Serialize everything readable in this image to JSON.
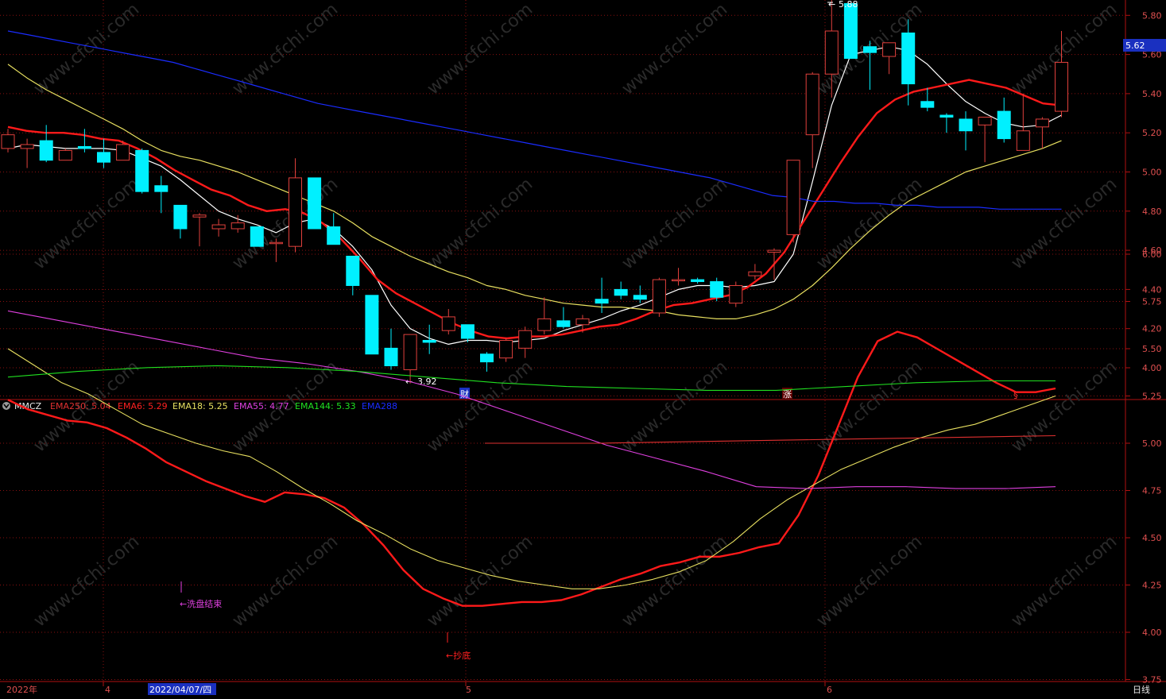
{
  "colors": {
    "bg": "#000000",
    "frame": "#b01010",
    "grid": "#8a1010",
    "up": "#e0403c",
    "down": "#00f0ff",
    "ema6": "#ff1a1a",
    "ema18": "#e8e060",
    "ema55": "#e040e0",
    "ema144": "#20e020",
    "ema250": "#e03030",
    "ema288": "#1a2cff",
    "ma_white": "#ffffff",
    "axis_text": "#e05050",
    "current_price_bg": "#1a30c0"
  },
  "main_panel": {
    "y_ticks": [
      "5.80",
      "5.60",
      "5.40",
      "5.20",
      "5.00",
      "4.80",
      "4.60",
      "4.40",
      "4.20",
      "4.00"
    ],
    "current_price": "5.62",
    "high_label": "5.88",
    "low_label": "3.92",
    "marker_cai": "财",
    "marker_zhang": "涨",
    "marker_s": "§"
  },
  "indicator_panel": {
    "name": "MMCZ",
    "legend": [
      {
        "key": "ema250",
        "text": "EMA250: 5.04"
      },
      {
        "key": "ema6",
        "text": "EMA6: 5.29"
      },
      {
        "key": "ema18",
        "text": "EMA18: 5.25"
      },
      {
        "key": "ema55",
        "text": "EMA55: 4.77"
      },
      {
        "key": "ema144",
        "text": "EMA144: 5.33"
      },
      {
        "key": "ema288",
        "text": "EMA288"
      }
    ],
    "y_ticks": [
      "6.00",
      "5.75",
      "5.50",
      "5.25",
      "5.00",
      "4.75",
      "4.50",
      "4.25",
      "4.00",
      "3.75"
    ],
    "annotation_wash": "←洗盘结束",
    "annotation_bottom": "←抄底"
  },
  "time_axis": {
    "labels": [
      "2022年",
      "4",
      "2022/04/07/四",
      "5",
      "6"
    ],
    "period": "日线"
  },
  "chart_data": [
    {
      "type": "candlestick",
      "panel": "price",
      "ylim": [
        3.85,
        5.88
      ],
      "candles": [
        {
          "o": 5.12,
          "h": 5.22,
          "l": 5.1,
          "c": 5.19
        },
        {
          "o": 5.12,
          "h": 5.17,
          "l": 5.02,
          "c": 5.14
        },
        {
          "o": 5.16,
          "h": 5.24,
          "l": 5.05,
          "c": 5.06
        },
        {
          "o": 5.06,
          "h": 5.12,
          "l": 5.06,
          "c": 5.11
        },
        {
          "o": 5.13,
          "h": 5.22,
          "l": 5.1,
          "c": 5.12
        },
        {
          "o": 5.1,
          "h": 5.17,
          "l": 5.02,
          "c": 5.05
        },
        {
          "o": 5.06,
          "h": 5.16,
          "l": 5.06,
          "c": 5.14
        },
        {
          "o": 5.11,
          "h": 5.12,
          "l": 4.89,
          "c": 4.9
        },
        {
          "o": 4.93,
          "h": 4.98,
          "l": 4.79,
          "c": 4.9
        },
        {
          "o": 4.83,
          "h": 4.83,
          "l": 4.66,
          "c": 4.71
        },
        {
          "o": 4.77,
          "h": 4.79,
          "l": 4.62,
          "c": 4.78
        },
        {
          "o": 4.71,
          "h": 4.76,
          "l": 4.67,
          "c": 4.73
        },
        {
          "o": 4.71,
          "h": 4.78,
          "l": 4.69,
          "c": 4.74
        },
        {
          "o": 4.72,
          "h": 4.72,
          "l": 4.62,
          "c": 4.62
        },
        {
          "o": 4.64,
          "h": 4.66,
          "l": 4.54,
          "c": 4.64
        },
        {
          "o": 4.62,
          "h": 5.07,
          "l": 4.59,
          "c": 4.97
        },
        {
          "o": 4.97,
          "h": 4.97,
          "l": 4.71,
          "c": 4.71
        },
        {
          "o": 4.72,
          "h": 4.79,
          "l": 4.63,
          "c": 4.63
        },
        {
          "o": 4.57,
          "h": 4.57,
          "l": 4.37,
          "c": 4.42
        },
        {
          "o": 4.37,
          "h": 4.37,
          "l": 4.07,
          "c": 4.07
        },
        {
          "o": 4.1,
          "h": 4.2,
          "l": 3.99,
          "c": 4.01
        },
        {
          "o": 3.99,
          "h": 4.17,
          "l": 3.92,
          "c": 4.17
        },
        {
          "o": 4.14,
          "h": 4.22,
          "l": 4.07,
          "c": 4.13
        },
        {
          "o": 4.19,
          "h": 4.3,
          "l": 4.17,
          "c": 4.26
        },
        {
          "o": 4.22,
          "h": 4.22,
          "l": 4.13,
          "c": 4.15
        },
        {
          "o": 4.07,
          "h": 4.08,
          "l": 3.98,
          "c": 4.03
        },
        {
          "o": 4.05,
          "h": 4.15,
          "l": 4.03,
          "c": 4.14
        },
        {
          "o": 4.1,
          "h": 4.21,
          "l": 4.05,
          "c": 4.19
        },
        {
          "o": 4.19,
          "h": 4.36,
          "l": 4.17,
          "c": 4.25
        },
        {
          "o": 4.24,
          "h": 4.31,
          "l": 4.2,
          "c": 4.21
        },
        {
          "o": 4.22,
          "h": 4.27,
          "l": 4.18,
          "c": 4.25
        },
        {
          "o": 4.35,
          "h": 4.46,
          "l": 4.28,
          "c": 4.33
        },
        {
          "o": 4.4,
          "h": 4.44,
          "l": 4.35,
          "c": 4.37
        },
        {
          "o": 4.37,
          "h": 4.42,
          "l": 4.33,
          "c": 4.35
        },
        {
          "o": 4.28,
          "h": 4.46,
          "l": 4.26,
          "c": 4.45
        },
        {
          "o": 4.45,
          "h": 4.51,
          "l": 4.42,
          "c": 4.45
        },
        {
          "o": 4.45,
          "h": 4.46,
          "l": 4.43,
          "c": 4.44
        },
        {
          "o": 4.44,
          "h": 4.46,
          "l": 4.34,
          "c": 4.36
        },
        {
          "o": 4.33,
          "h": 4.44,
          "l": 4.31,
          "c": 4.42
        },
        {
          "o": 4.47,
          "h": 4.53,
          "l": 4.45,
          "c": 4.49
        },
        {
          "o": 4.59,
          "h": 4.61,
          "l": 4.45,
          "c": 4.6
        },
        {
          "o": 4.68,
          "h": 5.06,
          "l": 4.64,
          "c": 5.06
        },
        {
          "o": 5.19,
          "h": 5.51,
          "l": 5.02,
          "c": 5.5
        },
        {
          "o": 5.5,
          "h": 5.88,
          "l": 5.38,
          "c": 5.72
        },
        {
          "o": 5.86,
          "h": 5.86,
          "l": 5.58,
          "c": 5.58
        },
        {
          "o": 5.64,
          "h": 5.67,
          "l": 5.42,
          "c": 5.61
        },
        {
          "o": 5.59,
          "h": 5.65,
          "l": 5.5,
          "c": 5.66
        },
        {
          "o": 5.71,
          "h": 5.78,
          "l": 5.34,
          "c": 5.45
        },
        {
          "o": 5.36,
          "h": 5.43,
          "l": 5.31,
          "c": 5.33
        },
        {
          "o": 5.29,
          "h": 5.3,
          "l": 5.2,
          "c": 5.28
        },
        {
          "o": 5.27,
          "h": 5.31,
          "l": 5.11,
          "c": 5.21
        },
        {
          "o": 5.24,
          "h": 5.28,
          "l": 5.05,
          "c": 5.28
        },
        {
          "o": 5.31,
          "h": 5.38,
          "l": 5.15,
          "c": 5.17
        },
        {
          "o": 5.11,
          "h": 5.4,
          "l": 5.11,
          "c": 5.21
        },
        {
          "o": 5.23,
          "h": 5.28,
          "l": 5.12,
          "c": 5.27
        },
        {
          "o": 5.31,
          "h": 5.72,
          "l": 5.28,
          "c": 5.56
        }
      ],
      "series": [
        {
          "key": "ma_white",
          "values": [
            5.12,
            5.14,
            5.13,
            5.12,
            5.12,
            5.12,
            5.11,
            5.07,
            5.03,
            4.96,
            4.88,
            4.8,
            4.76,
            4.73,
            4.69,
            4.74,
            4.76,
            4.71,
            4.62,
            4.5,
            4.32,
            4.2,
            4.15,
            4.12,
            4.14,
            4.14,
            4.13,
            4.14,
            4.15,
            4.19,
            4.22,
            4.25,
            4.29,
            4.32,
            4.36,
            4.4,
            4.42,
            4.42,
            4.41,
            4.42,
            4.44,
            4.58,
            4.95,
            5.34,
            5.6,
            5.62,
            5.64,
            5.62,
            5.55,
            5.45,
            5.36,
            5.3,
            5.25,
            5.23,
            5.24,
            5.29
          ]
        },
        {
          "key": "ema6",
          "values": [
            5.23,
            5.21,
            5.2,
            5.2,
            5.19,
            5.17,
            5.16,
            5.12,
            5.07,
            5.01,
            4.96,
            4.91,
            4.88,
            4.83,
            4.8,
            4.81,
            4.79,
            4.74,
            4.66,
            4.56,
            4.45,
            4.38,
            4.33,
            4.28,
            4.23,
            4.19,
            4.16,
            4.15,
            4.16,
            4.16,
            4.17,
            4.19,
            4.21,
            4.22,
            4.25,
            4.29,
            4.32,
            4.33,
            4.35,
            4.37,
            4.41,
            4.48,
            4.59,
            4.74,
            4.89,
            5.04,
            5.18,
            5.3,
            5.37,
            5.41,
            5.43,
            5.45,
            5.47,
            5.45,
            5.43,
            5.39,
            5.35,
            5.34
          ]
        },
        {
          "key": "ema18",
          "values": [
            5.55,
            5.48,
            5.42,
            5.37,
            5.32,
            5.27,
            5.22,
            5.16,
            5.11,
            5.08,
            5.06,
            5.03,
            5.0,
            4.96,
            4.92,
            4.88,
            4.84,
            4.8,
            4.74,
            4.67,
            4.62,
            4.57,
            4.53,
            4.49,
            4.46,
            4.42,
            4.4,
            4.37,
            4.35,
            4.33,
            4.32,
            4.31,
            4.31,
            4.3,
            4.29,
            4.27,
            4.26,
            4.25,
            4.25,
            4.27,
            4.3,
            4.35,
            4.42,
            4.51,
            4.61,
            4.7,
            4.78,
            4.85,
            4.9,
            4.95,
            5.0,
            5.03,
            5.06,
            5.09,
            5.12,
            5.16
          ]
        },
        {
          "key": "ema288",
          "values": [
            5.72,
            5.7,
            5.68,
            5.66,
            5.64,
            5.62,
            5.6,
            5.58,
            5.56,
            5.53,
            5.5,
            5.47,
            5.44,
            5.41,
            5.38,
            5.35,
            5.33,
            5.31,
            5.29,
            5.27,
            5.25,
            5.23,
            5.21,
            5.19,
            5.17,
            5.15,
            5.13,
            5.11,
            5.09,
            5.07,
            5.05,
            5.03,
            5.01,
            4.99,
            4.97,
            4.94,
            4.91,
            4.88,
            4.87,
            4.85,
            4.85,
            4.84,
            4.84,
            4.83,
            4.83,
            4.82,
            4.82,
            4.82,
            4.81,
            4.81,
            4.81,
            4.81
          ]
        }
      ]
    },
    {
      "type": "line",
      "panel": "indicator",
      "title": "MMCZ",
      "ylim": [
        3.62,
        6.28
      ],
      "series": [
        {
          "name": "EMA6",
          "key": "ema6",
          "values": [
            5.23,
            5.18,
            5.15,
            5.12,
            5.11,
            5.08,
            5.03,
            4.97,
            4.9,
            4.85,
            4.8,
            4.76,
            4.72,
            4.69,
            4.74,
            4.73,
            4.71,
            4.66,
            4.57,
            4.46,
            4.33,
            4.23,
            4.18,
            4.14,
            4.14,
            4.15,
            4.16,
            4.16,
            4.17,
            4.2,
            4.24,
            4.28,
            4.31,
            4.35,
            4.37,
            4.4,
            4.4,
            4.42,
            4.45,
            4.47,
            4.62,
            4.83,
            5.09,
            5.35,
            5.54,
            5.59,
            5.56,
            5.5,
            5.44,
            5.38,
            5.32,
            5.27,
            5.27,
            5.29
          ]
        },
        {
          "name": "EMA18",
          "key": "ema18",
          "values": [
            5.5,
            5.41,
            5.32,
            5.26,
            5.18,
            5.1,
            5.05,
            5.0,
            4.96,
            4.93,
            4.85,
            4.76,
            4.68,
            4.59,
            4.52,
            4.44,
            4.38,
            4.34,
            4.3,
            4.27,
            4.25,
            4.23,
            4.23,
            4.25,
            4.28,
            4.32,
            4.38,
            4.48,
            4.6,
            4.7,
            4.78,
            4.86,
            4.92,
            4.98,
            5.03,
            5.07,
            5.1,
            5.15,
            5.2,
            5.25
          ]
        },
        {
          "name": "EMA55",
          "key": "ema55",
          "values": [
            5.7,
            5.65,
            5.6,
            5.55,
            5.5,
            5.45,
            5.42,
            5.38,
            5.33,
            5.26,
            5.17,
            5.08,
            4.99,
            4.92,
            4.85,
            4.77,
            4.76,
            4.77,
            4.77,
            4.76,
            4.76,
            4.77
          ]
        },
        {
          "name": "EMA144",
          "key": "ema144",
          "values": [
            5.35,
            5.38,
            5.4,
            5.41,
            5.4,
            5.38,
            5.35,
            5.32,
            5.3,
            5.29,
            5.28,
            5.28,
            5.3,
            5.32,
            5.33,
            5.33
          ]
        },
        {
          "name": "EMA250",
          "key": "ema250",
          "values": [
            5.0,
            5.0,
            5.01,
            5.02,
            5.03,
            5.04
          ]
        }
      ]
    }
  ]
}
